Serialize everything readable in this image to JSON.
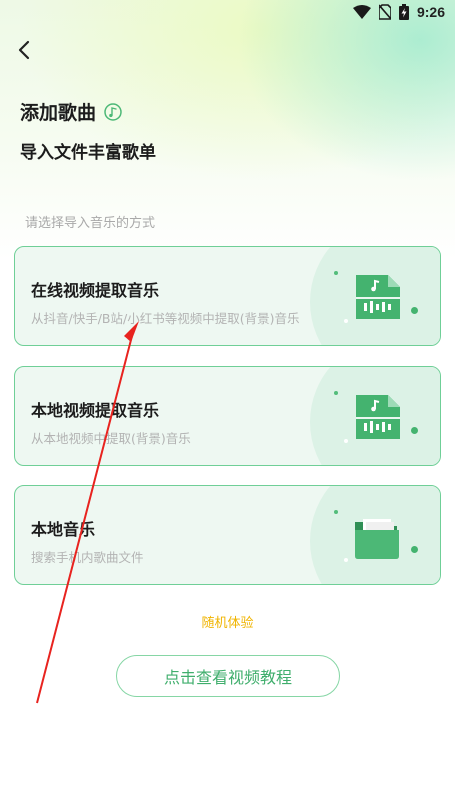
{
  "status_bar": {
    "time": "9:26",
    "icons": [
      "wifi-icon",
      "no-sim-icon",
      "battery-icon"
    ]
  },
  "header": {
    "back_icon": "chevron-left-icon",
    "title": "添加歌曲",
    "title_icon": "music-note-icon",
    "subtitle": "导入文件丰富歌单"
  },
  "hint": "请选择导入音乐的方式",
  "options": [
    {
      "title": "在线视频提取音乐",
      "desc": "从抖音/快手/B站/小红书等视频中提取(背景)音乐",
      "icon": "audio-file-icon"
    },
    {
      "title": "本地视频提取音乐",
      "desc": "从本地视频中提取(背景)音乐",
      "icon": "audio-file-icon"
    },
    {
      "title": "本地音乐",
      "desc": "搜索手机内歌曲文件",
      "icon": "folder-icon"
    }
  ],
  "random_label": "随机体验",
  "tutorial_button": "点击查看视频教程",
  "colors": {
    "accent": "#4cb876",
    "card_border": "#6fcf97",
    "card_bg": "#eef8f2",
    "random_text": "#f0b400",
    "annotation_arrow": "#e8231f"
  }
}
